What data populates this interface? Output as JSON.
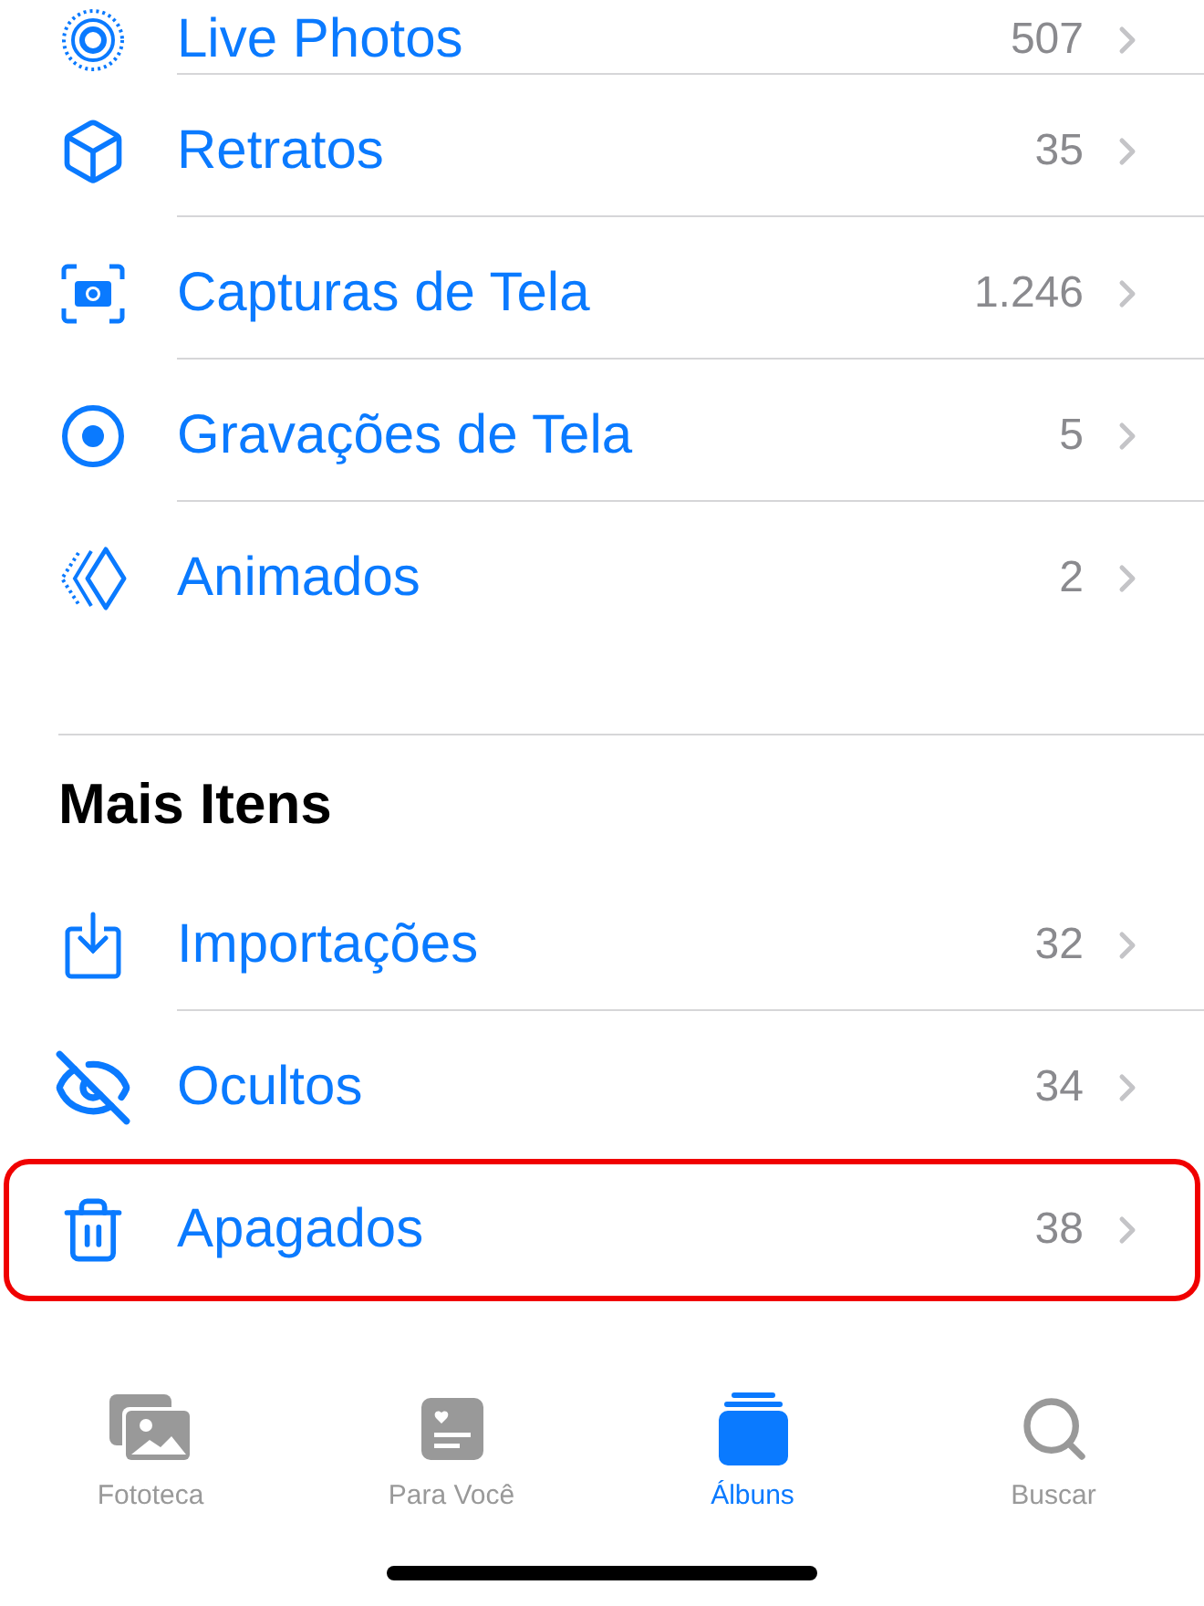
{
  "sections": [
    {
      "items": [
        {
          "label": "Live Photos",
          "count": "507",
          "highlighted": false
        },
        {
          "label": "Retratos",
          "count": "35",
          "highlighted": false
        },
        {
          "label": "Capturas de Tela",
          "count": "1.246",
          "highlighted": false
        },
        {
          "label": "Gravações de Tela",
          "count": "5",
          "highlighted": false
        },
        {
          "label": "Animados",
          "count": "2",
          "highlighted": false
        }
      ]
    },
    {
      "title": "Mais Itens",
      "items": [
        {
          "label": "Importações",
          "count": "32",
          "highlighted": false
        },
        {
          "label": "Ocultos",
          "count": "34",
          "highlighted": false
        },
        {
          "label": "Apagados",
          "count": "38",
          "highlighted": true
        }
      ]
    }
  ],
  "tab_bar": [
    {
      "label": "Fototeca",
      "selected": false
    },
    {
      "label": "Para Você",
      "selected": false
    },
    {
      "label": "Álbuns",
      "selected": true
    },
    {
      "label": "Buscar",
      "selected": false
    }
  ]
}
